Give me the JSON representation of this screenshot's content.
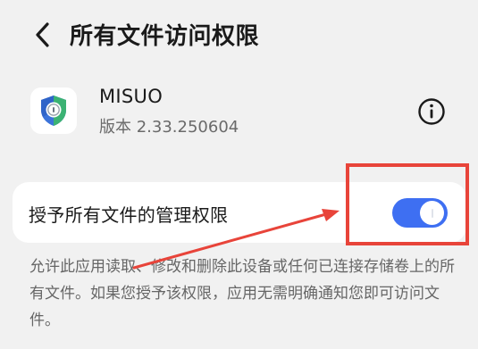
{
  "header": {
    "back_icon": "chevron-left-icon",
    "title": "所有文件访问权限"
  },
  "app": {
    "icon": "shield-keyhole-icon",
    "name": "MISUO",
    "version": "版本 2.33.250604",
    "info_icon": "info-circle-icon"
  },
  "permission": {
    "label": "授予所有文件的管理权限",
    "enabled": true,
    "toggle_color": "#3e6ff2"
  },
  "description": "允许此应用读取、修改和删除此设备或任何已连接存储卷上的所有文件。如果您授予该权限，应用无需明确通知您即可访问文件。",
  "annotation_color": "#e8443a"
}
